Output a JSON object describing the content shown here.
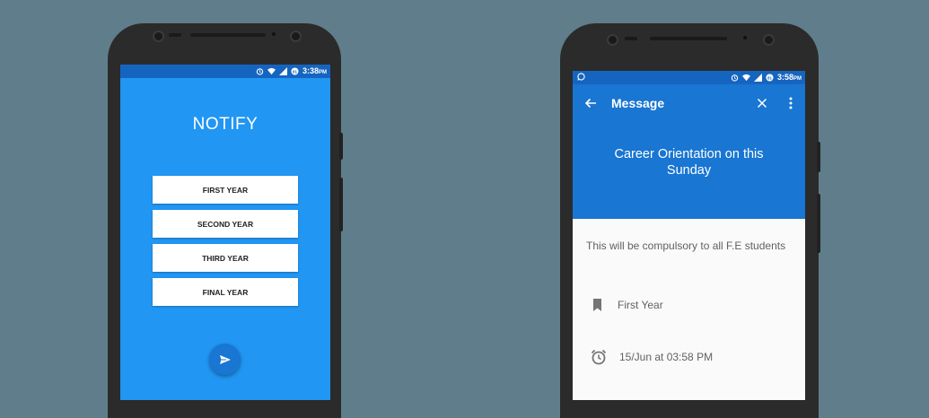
{
  "left_phone": {
    "status": {
      "time": "3:38",
      "ampm": "PM",
      "icons": [
        "alarm-icon",
        "wifi-icon",
        "signal-icon",
        "battery-icon"
      ]
    },
    "title": "NOTIFY",
    "buttons": [
      {
        "label": "FIRST YEAR"
      },
      {
        "label": "SECOND YEAR"
      },
      {
        "label": "THIRD YEAR"
      },
      {
        "label": "FINAL YEAR"
      }
    ],
    "fab_icon": "send-icon"
  },
  "right_phone": {
    "status": {
      "time": "3:58",
      "ampm": "PM",
      "left_icon": "whatsapp-icon",
      "icons": [
        "alarm-icon",
        "wifi-icon",
        "signal-icon",
        "battery-icon"
      ]
    },
    "toolbar": {
      "title": "Message",
      "back_icon": "back-arrow-icon",
      "close_icon": "close-icon",
      "menu_icon": "more-vert-icon"
    },
    "header": "Career Orientation on this Sunday",
    "body": "This will be compulsory to all F.E students",
    "category": {
      "icon": "bookmark-icon",
      "label": "First Year"
    },
    "timestamp": {
      "icon": "alarm-icon",
      "label": "15/Jun at 03:58 PM"
    }
  },
  "colors": {
    "background": "#607D8B",
    "primary": "#2196F3",
    "primary_dark": "#1976D2",
    "status_bar": "#1565C0"
  }
}
